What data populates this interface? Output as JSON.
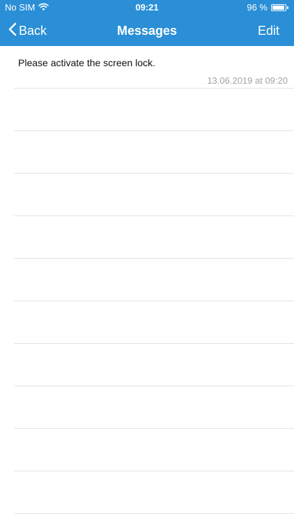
{
  "status_bar": {
    "carrier": "No SIM",
    "time": "09:21",
    "battery_text": "96 %",
    "battery_level": 0.96
  },
  "nav": {
    "back_label": "Back",
    "title": "Messages",
    "edit_label": "Edit"
  },
  "messages": [
    {
      "text": "Please activate the screen lock.",
      "timestamp": "13.06.2019 at 09:20"
    }
  ],
  "colors": {
    "header": "#2a8fd6",
    "separator": "#e4e4e4",
    "timestamp": "#a3a3a3"
  }
}
